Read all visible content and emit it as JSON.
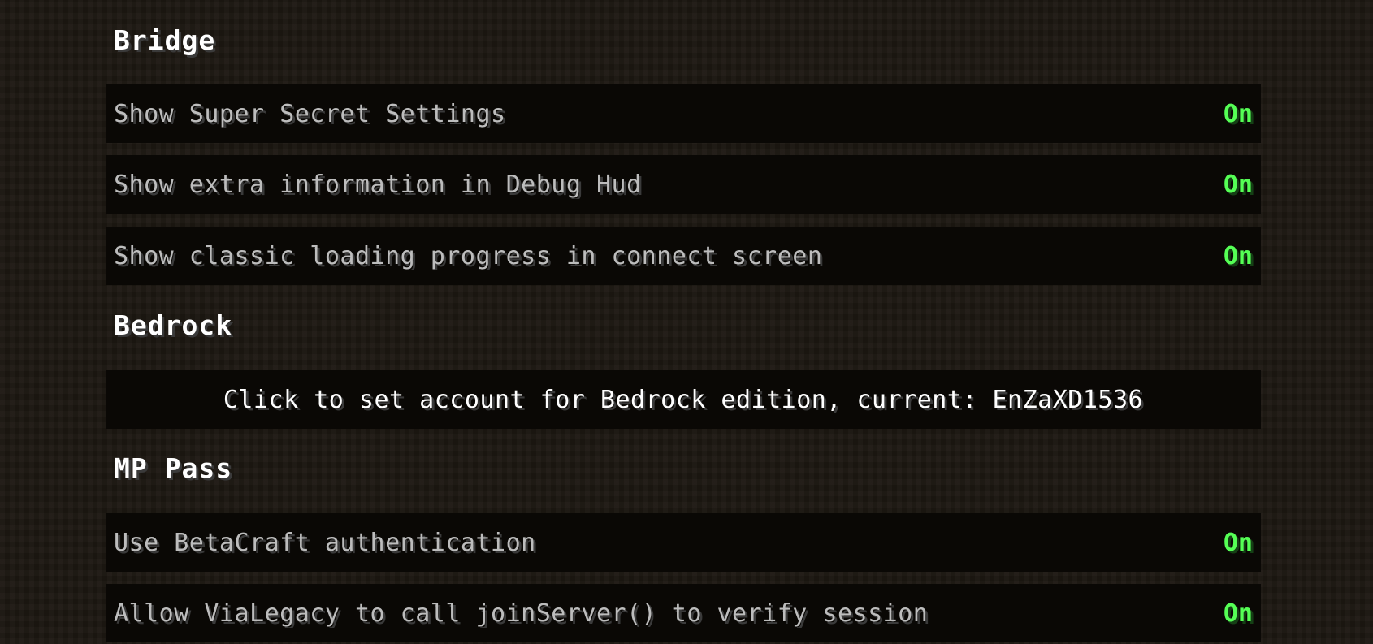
{
  "sections": [
    {
      "title": "Bridge",
      "options": [
        {
          "label": "Show Super Secret Settings",
          "value": "On"
        },
        {
          "label": "Show extra information in Debug Hud",
          "value": "On"
        },
        {
          "label": "Show classic loading progress in connect screen",
          "value": "On"
        }
      ]
    },
    {
      "title": "Bedrock",
      "button": {
        "label": "Click to set account for Bedrock edition, current: EnZaXD1536"
      }
    },
    {
      "title": "MP Pass",
      "options": [
        {
          "label": "Use BetaCraft authentication",
          "value": "On"
        },
        {
          "label": "Allow ViaLegacy to call joinServer() to verify session",
          "value": "On"
        }
      ]
    }
  ],
  "colors": {
    "on_value": "#55ff55",
    "row_background": "#0a0805",
    "label_text": "#bdbdbd",
    "title_text": "#ffffff"
  }
}
